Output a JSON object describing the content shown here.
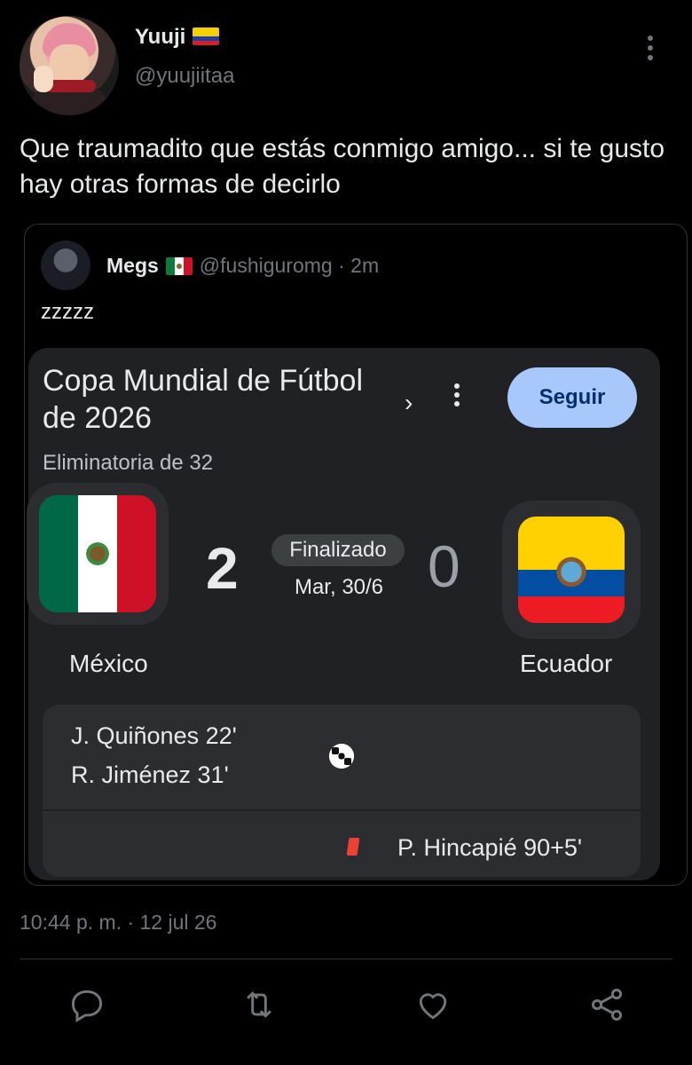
{
  "author": {
    "name": "Yuuji",
    "handle": "@yuujiitaa"
  },
  "tweet": {
    "text": "Que traumadito que estás conmigo amigo... si te gusto hay otras formas de decirlo"
  },
  "quoted": {
    "name": "Megs",
    "handle": "@fushiguromg · 2m",
    "text": "zzzzz",
    "card": {
      "title": "Copa Mundial de Fútbol de 2026",
      "chevron": "›",
      "follow_label": "Seguir",
      "round": "Eliminatoria de 32",
      "home": {
        "team": "México",
        "score": "2"
      },
      "away": {
        "team": "Ecuador",
        "score": "0"
      },
      "status": "Finalizado",
      "date": "Mar, 30/6",
      "events": {
        "home_goals": [
          "J. Quiñones 22'",
          "R. Jiménez 31'"
        ],
        "away_cards": [
          "P. Hincapié 90+5'"
        ]
      }
    }
  },
  "timestamp": "10:44 p. m. · 12 jul 26",
  "colors": {
    "background": "#000000",
    "card_bg": "#202124",
    "follow_bg": "#a8c7fa",
    "muted": "#71767b"
  },
  "icons": {
    "reply": "reply-icon",
    "retweet": "retweet-icon",
    "like": "heart-icon",
    "share": "share-icon"
  }
}
